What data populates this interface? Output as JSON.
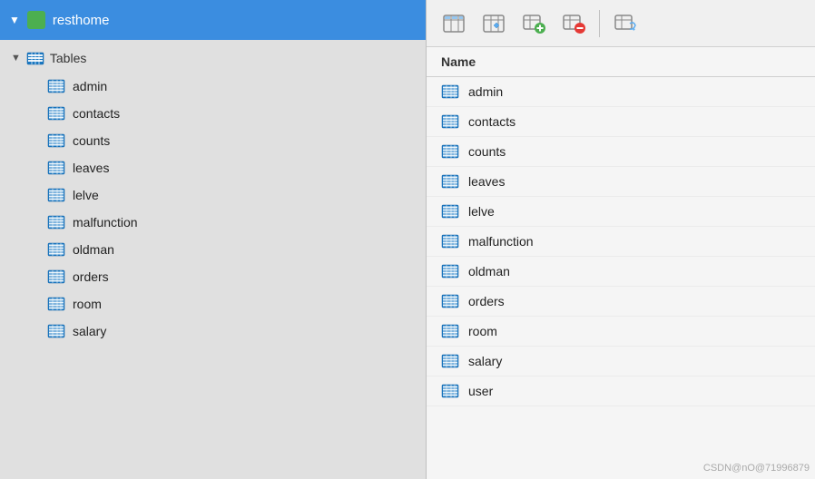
{
  "left": {
    "db_name": "resthome",
    "tables_label": "Tables",
    "items": [
      {
        "label": "admin"
      },
      {
        "label": "contacts"
      },
      {
        "label": "counts"
      },
      {
        "label": "leaves"
      },
      {
        "label": "lelve"
      },
      {
        "label": "malfunction"
      },
      {
        "label": "oldman"
      },
      {
        "label": "orders"
      },
      {
        "label": "room"
      },
      {
        "label": "salary"
      }
    ]
  },
  "right": {
    "col_header": "Name",
    "items": [
      {
        "label": "admin"
      },
      {
        "label": "contacts"
      },
      {
        "label": "counts"
      },
      {
        "label": "leaves"
      },
      {
        "label": "lelve"
      },
      {
        "label": "malfunction"
      },
      {
        "label": "oldman"
      },
      {
        "label": "orders"
      },
      {
        "label": "room"
      },
      {
        "label": "salary"
      },
      {
        "label": "user"
      }
    ]
  },
  "toolbar": {
    "btn1_title": "Table view",
    "btn2_title": "Edit",
    "btn3_title": "Add",
    "btn4_title": "Remove",
    "btn5_title": "Refresh"
  },
  "watermark": "CSDN@nO@71996879"
}
